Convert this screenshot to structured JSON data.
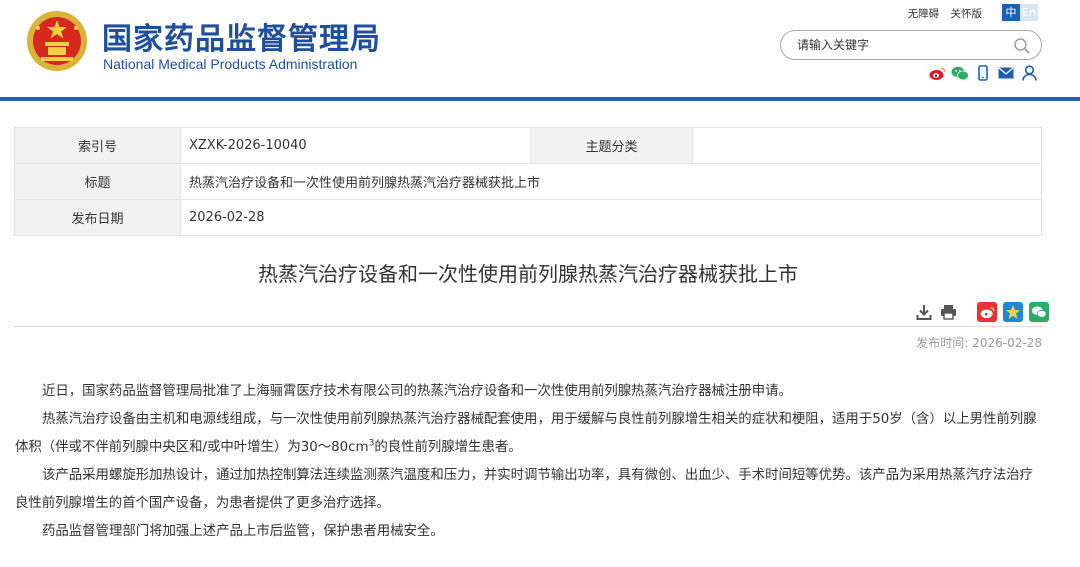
{
  "header": {
    "site_name_cn": "国家药品监督管理局",
    "site_name_en": "National Medical Products Administration",
    "links": {
      "accessibility": "无障碍",
      "elder": "关怀版"
    },
    "lang": {
      "zh": "中",
      "en": "En"
    },
    "search": {
      "placeholder": "请输入关键字"
    },
    "social_icons": [
      "weibo-icon",
      "wechat-icon",
      "mobile-icon",
      "mail-icon",
      "user-icon"
    ],
    "brand_color": "#1e5fb4"
  },
  "info": {
    "index_label": "索引号",
    "index_value": "XZXK-2026-10040",
    "topic_label": "主题分类",
    "topic_value": "",
    "title_label": "标题",
    "title_value": "热蒸汽治疗设备和一次性使用前列腺热蒸汽治疗器械获批上市",
    "date_label": "发布日期",
    "date_value": "2026-02-28"
  },
  "article": {
    "title": "热蒸汽治疗设备和一次性使用前列腺热蒸汽治疗器械获批上市",
    "tools": [
      "download-icon",
      "print-icon",
      "share-weibo-icon",
      "share-qzone-icon",
      "share-wechat-icon"
    ],
    "publish_label": "发布时间:",
    "publish_date": "2026-02-28",
    "paragraphs": {
      "p1": "近日，国家药品监督管理局批准了上海骊霄医疗技术有限公司的热蒸汽治疗设备和一次性使用前列腺热蒸汽治疗器械注册申请。",
      "p2_before": "热蒸汽治疗设备由主机和电源线组成，与一次性使用前列腺热蒸汽治疗器械配套使用，用于缓解与良性前列腺增生相关的症状和梗阻，适用于50岁（含）以上男性前列腺体积（伴或不伴前列腺中央区和/或中叶增生）为30～80cm",
      "p2_sup": "3",
      "p2_after": "的良性前列腺增生患者。",
      "p3": "该产品采用螺旋形加热设计，通过加热控制算法连续监测蒸汽温度和压力，并实时调节输出功率，具有微创、出血少、手术时间短等优势。该产品为采用热蒸汽疗法治疗良性前列腺增生的首个国产设备，为患者提供了更多治疗选择。",
      "p4": "药品监督管理部门将加强上述产品上市后监管，保护患者用械安全。"
    }
  }
}
